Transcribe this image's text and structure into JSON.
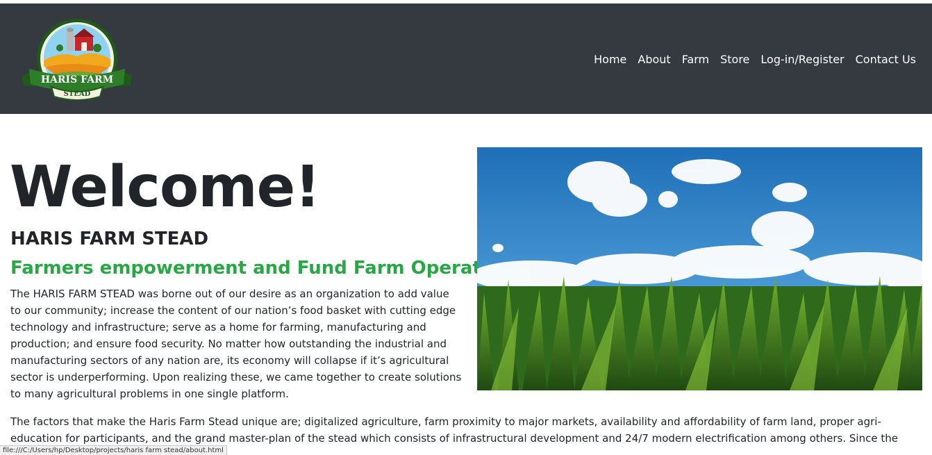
{
  "brand": {
    "logo_line1": "HARIS FARM",
    "logo_line2": "STEAD"
  },
  "nav": {
    "items": [
      {
        "label": "Home"
      },
      {
        "label": "About"
      },
      {
        "label": "Farm"
      },
      {
        "label": "Store"
      },
      {
        "label": "Log-in/Register"
      },
      {
        "label": "Contact Us"
      }
    ]
  },
  "main": {
    "welcome": "Welcome!",
    "subtitle": "HARIS FARM STEAD",
    "tagline": "Farmers empowerment and Fund Farm Operations",
    "intro": "The HARIS FARM STEAD was borne out of our desire as an organization to add value to our community; increase the content of our nation’s food basket with cutting edge technology and infrastructure; serve as a home for farming, manufacturing and production; and ensure food security. No matter how outstanding the industrial and manufacturing sectors of any nation are, its economy will collapse if it’s agricultural sector is underperforming. Upon realizing these, we came together to create solutions to many agricultural problems in one single platform.",
    "factors": "The factors that make the Haris Farm Stead unique are; digitalized agriculture, farm proximity to major markets, availability and affordability of farm land, proper agri-education for participants, and the grand master-plan of the stead which consists of infrastructural development and 24/7 modern electrification among others. Since the inception of the HARIS FARM"
  },
  "status": {
    "url": "file:///C:/Users/hp/Desktop/projects/haris farm stead/about.html"
  },
  "colors": {
    "navbar": "#343a40",
    "accent_green": "#28a745",
    "text": "#212529"
  }
}
